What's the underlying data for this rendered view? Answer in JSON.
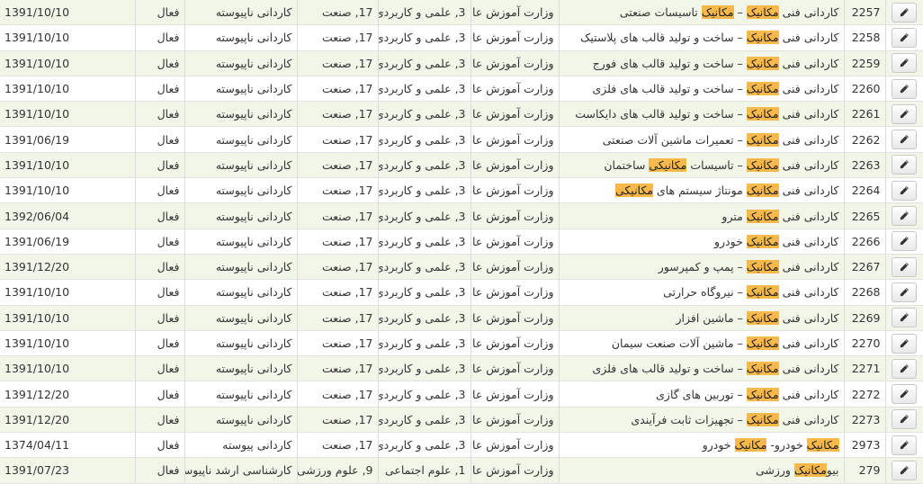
{
  "rows": [
    {
      "id": "2257",
      "title": [
        {
          "t": "کاردانی فنی "
        },
        {
          "t": "مکانیک",
          "hl": true
        },
        {
          "t": " – "
        },
        {
          "t": "مکانیک",
          "hl": true
        },
        {
          "t": " تاسیسات صنعتی"
        }
      ],
      "org": "وزارت آموزش عالی",
      "group": "3, علمی و کاربردی",
      "field": "17, صنعت",
      "degree": "کاردانی ناپیوسته",
      "status": "فعال",
      "date": "1391/10/10"
    },
    {
      "id": "2258",
      "title": [
        {
          "t": "کاردانی فنی "
        },
        {
          "t": "مکانیک",
          "hl": true
        },
        {
          "t": " – ساخت و تولید قالب های پلاستیک"
        }
      ],
      "org": "وزارت آموزش عالی",
      "group": "3, علمی و کاربردی",
      "field": "17, صنعت",
      "degree": "کاردانی ناپیوسته",
      "status": "فعال",
      "date": "1391/10/10"
    },
    {
      "id": "2259",
      "title": [
        {
          "t": "کاردانی فنی "
        },
        {
          "t": "مکانیک",
          "hl": true
        },
        {
          "t": " – ساخت و تولید قالب های فورج"
        }
      ],
      "org": "وزارت آموزش عالی",
      "group": "3, علمی و کاربردی",
      "field": "17, صنعت",
      "degree": "کاردانی ناپیوسته",
      "status": "فعال",
      "date": "1391/10/10"
    },
    {
      "id": "2260",
      "title": [
        {
          "t": "کاردانی فنی "
        },
        {
          "t": "مکانیک",
          "hl": true
        },
        {
          "t": " – ساخت و تولید قالب های فلزی"
        }
      ],
      "org": "وزارت آموزش عالی",
      "group": "3, علمی و کاربردی",
      "field": "17, صنعت",
      "degree": "کاردانی ناپیوسته",
      "status": "فعال",
      "date": "1391/10/10"
    },
    {
      "id": "2261",
      "title": [
        {
          "t": "کاردانی فنی "
        },
        {
          "t": "مکانیک",
          "hl": true
        },
        {
          "t": " – ساخت و تولید قالب های دایکاست"
        }
      ],
      "org": "وزارت آموزش عالی",
      "group": "3, علمی و کاربردی",
      "field": "17, صنعت",
      "degree": "کاردانی ناپیوسته",
      "status": "فعال",
      "date": "1391/10/10"
    },
    {
      "id": "2262",
      "title": [
        {
          "t": "کاردانی فنی "
        },
        {
          "t": "مکانیک",
          "hl": true
        },
        {
          "t": " – تعمیرات ماشین آلات صنعتی"
        }
      ],
      "org": "وزارت آموزش عالی",
      "group": "3, علمی و کاربردی",
      "field": "17, صنعت",
      "degree": "کاردانی ناپیوسته",
      "status": "فعال",
      "date": "1391/06/19"
    },
    {
      "id": "2263",
      "title": [
        {
          "t": "کاردانی فنی "
        },
        {
          "t": "مکانیک",
          "hl": true
        },
        {
          "t": " – تاسیسات "
        },
        {
          "t": "مکانیکی",
          "hl": true
        },
        {
          "t": " ساختمان"
        }
      ],
      "org": "وزارت آموزش عالی",
      "group": "3, علمی و کاربردی",
      "field": "17, صنعت",
      "degree": "کاردانی ناپیوسته",
      "status": "فعال",
      "date": "1391/10/10"
    },
    {
      "id": "2264",
      "title": [
        {
          "t": "کاردانی فنی "
        },
        {
          "t": "مکانیک",
          "hl": true
        },
        {
          "t": " مونتاژ سیستم های "
        },
        {
          "t": "مکانیکی",
          "hl": true
        }
      ],
      "org": "وزارت آموزش عالی",
      "group": "3, علمی و کاربردی",
      "field": "17, صنعت",
      "degree": "کاردانی ناپیوسته",
      "status": "فعال",
      "date": "1391/10/10"
    },
    {
      "id": "2265",
      "title": [
        {
          "t": "کاردانی فنی "
        },
        {
          "t": "مکانیک",
          "hl": true
        },
        {
          "t": " مترو"
        }
      ],
      "org": "وزارت آموزش عالی",
      "group": "3, علمی و کاربردی",
      "field": "17, صنعت",
      "degree": "کاردانی ناپیوسته",
      "status": "فعال",
      "date": "1392/06/04"
    },
    {
      "id": "2266",
      "title": [
        {
          "t": "کاردانی فنی "
        },
        {
          "t": "مکانیک",
          "hl": true
        },
        {
          "t": " خودرو"
        }
      ],
      "org": "وزارت آموزش عالی",
      "group": "3, علمی و کاربردی",
      "field": "17, صنعت",
      "degree": "کاردانی ناپیوسته",
      "status": "فعال",
      "date": "1391/06/19"
    },
    {
      "id": "2267",
      "title": [
        {
          "t": "کاردانی فنی "
        },
        {
          "t": "مکانیک",
          "hl": true
        },
        {
          "t": " – پمپ و کمپرسور"
        }
      ],
      "org": "وزارت آموزش عالی",
      "group": "3, علمی و کاربردی",
      "field": "17, صنعت",
      "degree": "کاردانی ناپیوسته",
      "status": "فعال",
      "date": "1391/12/20"
    },
    {
      "id": "2268",
      "title": [
        {
          "t": "کاردانی فنی "
        },
        {
          "t": "مکانیک",
          "hl": true
        },
        {
          "t": " – نیروگاه حرارتی"
        }
      ],
      "org": "وزارت آموزش عالی",
      "group": "3, علمی و کاربردی",
      "field": "17, صنعت",
      "degree": "کاردانی ناپیوسته",
      "status": "فعال",
      "date": "1391/10/10"
    },
    {
      "id": "2269",
      "title": [
        {
          "t": "کاردانی فنی "
        },
        {
          "t": "مکانیک",
          "hl": true
        },
        {
          "t": " – ماشین افزار"
        }
      ],
      "org": "وزارت آموزش عالی",
      "group": "3, علمی و کاربردی",
      "field": "17, صنعت",
      "degree": "کاردانی ناپیوسته",
      "status": "فعال",
      "date": "1391/10/10"
    },
    {
      "id": "2270",
      "title": [
        {
          "t": "کاردانی فنی "
        },
        {
          "t": "مکانیک",
          "hl": true
        },
        {
          "t": " – ماشین آلات صنعت سیمان"
        }
      ],
      "org": "وزارت آموزش عالی",
      "group": "3, علمی و کاربردی",
      "field": "17, صنعت",
      "degree": "کاردانی ناپیوسته",
      "status": "فعال",
      "date": "1391/10/10"
    },
    {
      "id": "2271",
      "title": [
        {
          "t": "کاردانی فنی "
        },
        {
          "t": "مکانیک",
          "hl": true
        },
        {
          "t": " – ساخت و تولید قالب های فلزی"
        }
      ],
      "org": "وزارت آموزش عالی",
      "group": "3, علمی و کاربردی",
      "field": "17, صنعت",
      "degree": "کاردانی ناپیوسته",
      "status": "فعال",
      "date": "1391/10/10"
    },
    {
      "id": "2272",
      "title": [
        {
          "t": "کاردانی فنی "
        },
        {
          "t": "مکانیک",
          "hl": true
        },
        {
          "t": " – توربین های گازی"
        }
      ],
      "org": "وزارت آموزش عالی",
      "group": "3, علمی و کاربردی",
      "field": "17, صنعت",
      "degree": "کاردانی ناپیوسته",
      "status": "فعال",
      "date": "1391/12/20"
    },
    {
      "id": "2273",
      "title": [
        {
          "t": "کاردانی فنی "
        },
        {
          "t": "مکانیک",
          "hl": true
        },
        {
          "t": " – تجهیزات ثابت فرآیندی"
        }
      ],
      "org": "وزارت آموزش عالی",
      "group": "3, علمی و کاربردی",
      "field": "17, صنعت",
      "degree": "کاردانی ناپیوسته",
      "status": "فعال",
      "date": "1391/12/20"
    },
    {
      "id": "2973",
      "title": [
        {
          "t": "مکانیک",
          "hl": true
        },
        {
          "t": " خودرو- "
        },
        {
          "t": "مکانیک",
          "hl": true
        },
        {
          "t": " خودرو"
        }
      ],
      "org": "وزارت آموزش عالی",
      "group": "3, علمی و کاربردی",
      "field": "17, صنعت",
      "degree": "کاردانی پیوسته",
      "status": "فعال",
      "date": "1374/04/11"
    },
    {
      "id": "279",
      "title": [
        {
          "t": "بیو"
        },
        {
          "t": "مکانیک",
          "hl": true
        },
        {
          "t": " ورزشی"
        }
      ],
      "org": "وزارت آموزش عالی",
      "group": "1, علوم اجتماعی",
      "field": "9, علوم ورزشی",
      "degree": "کارشناسی ارشد ناپیوسته",
      "status": "فعال",
      "date": "1391/07/23"
    }
  ],
  "icons": {
    "edit": "pencil-icon"
  },
  "colors": {
    "highlight": "#f9b84a",
    "row_alt": "#f1f6e8"
  }
}
